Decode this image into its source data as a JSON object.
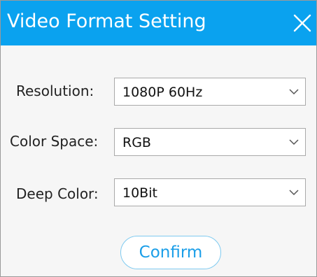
{
  "window": {
    "title": "Video Format Setting",
    "close_icon": "close-icon"
  },
  "colors": {
    "titlebar": "#0aa2ef",
    "accent_text": "#1a9ee8",
    "confirm_border": "#7fcaf0"
  },
  "form": {
    "resolution": {
      "label": "Resolution:",
      "value": "1080P 60Hz"
    },
    "color_space": {
      "label": "Color Space:",
      "value": "RGB"
    },
    "deep_color": {
      "label": "Deep Color:",
      "value": "10Bit"
    }
  },
  "actions": {
    "confirm_label": "Confirm"
  }
}
